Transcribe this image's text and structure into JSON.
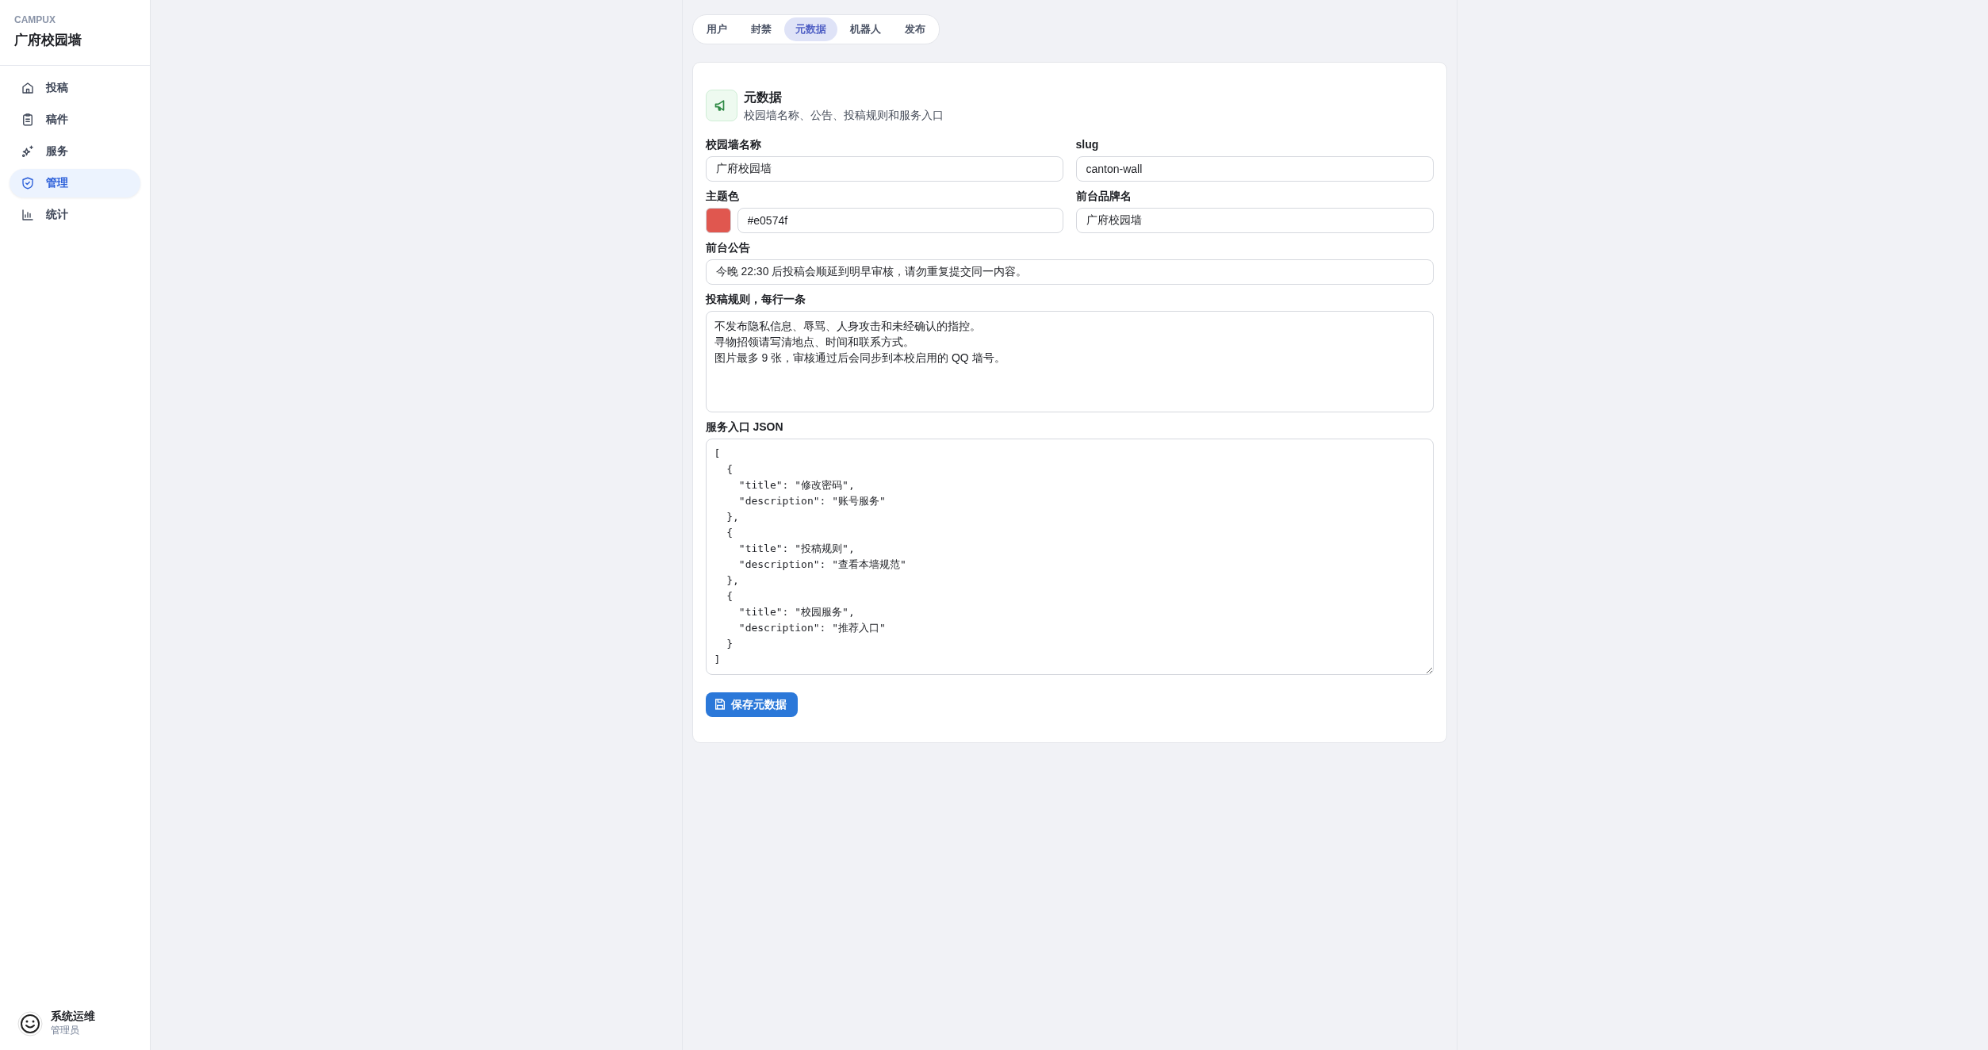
{
  "sidebar": {
    "brand": "CAMPUX",
    "title": "广府校园墙",
    "items": [
      {
        "label": "投稿",
        "selected": false
      },
      {
        "label": "稿件",
        "selected": false
      },
      {
        "label": "服务",
        "selected": false
      },
      {
        "label": "管理",
        "selected": true
      },
      {
        "label": "统计",
        "selected": false
      }
    ],
    "user": {
      "name": "系统运维",
      "role": "管理员"
    }
  },
  "tabs": [
    {
      "label": "用户",
      "selected": false
    },
    {
      "label": "封禁",
      "selected": false
    },
    {
      "label": "元数据",
      "selected": true
    },
    {
      "label": "机器人",
      "selected": false
    },
    {
      "label": "发布",
      "selected": false
    }
  ],
  "panel": {
    "title": "元数据",
    "subtitle": "校园墙名称、公告、投稿规则和服务入口",
    "rows": [
      [
        {
          "kind": "text",
          "label": "校园墙名称",
          "value": "广府校园墙"
        },
        {
          "kind": "text",
          "label": "slug",
          "value": "canton-wall"
        }
      ],
      [
        {
          "kind": "color",
          "label": "主题色",
          "value": "#e0574f"
        },
        {
          "kind": "text",
          "label": "前台品牌名",
          "value": "广府校园墙"
        }
      ],
      [
        {
          "kind": "text",
          "label": "前台公告",
          "value": "今晚 22:30 后投稿会顺延到明早审核，请勿重复提交同一内容。"
        }
      ],
      [
        {
          "kind": "textarea",
          "label": "投稿规则，每行一条",
          "lines": [
            "不发布隐私信息、辱骂、人身攻击和未经确认的指控。",
            "寻物招领请写清地点、时间和联系方式。",
            "图片最多 9 张，审核通过后会同步到本校启用的 QQ 墙号。"
          ]
        }
      ],
      [
        {
          "kind": "code",
          "label": "服务入口 JSON",
          "value": "[\n  {\n    \"title\": \"修改密码\",\n    \"description\": \"账号服务\"\n  },\n  {\n    \"title\": \"投稿规则\",\n    \"description\": \"查看本墙规范\"\n  },\n  {\n    \"title\": \"校园服务\",\n    \"description\": \"推荐入口\"\n  }\n]"
        }
      ]
    ],
    "save_button": "保存元数据"
  }
}
